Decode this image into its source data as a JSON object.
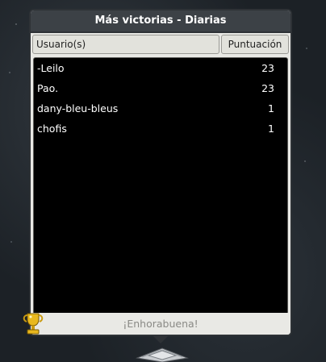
{
  "window": {
    "title": "Más victorias - Diarias",
    "columns": {
      "user": "Usuario(s)",
      "score": "Puntuación"
    },
    "rows": [
      {
        "user": "-Leilo",
        "score": "23"
      },
      {
        "user": "Pao.",
        "score": "23"
      },
      {
        "user": "dany-bleu-bleus",
        "score": "1"
      },
      {
        "user": "chofis",
        "score": "1"
      }
    ],
    "footer": "¡Enhorabuena!"
  },
  "icons": {
    "trophy": "trophy-icon",
    "base": "furniture-base-icon"
  },
  "colors": {
    "titlebar": "#3c4146",
    "list_bg": "#000000",
    "panel": "#e9e9e5",
    "trophy": "#e8b81e"
  }
}
